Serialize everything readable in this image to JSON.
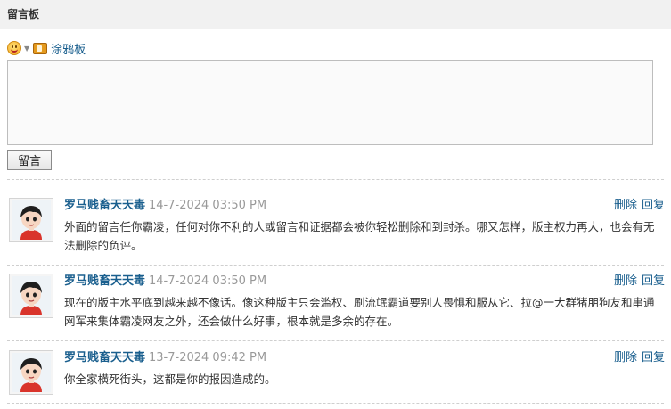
{
  "header": {
    "title": "留言板"
  },
  "editor": {
    "doodle_label": "涂鸦板",
    "textarea_value": "",
    "submit_label": "留言"
  },
  "comments": [
    {
      "author": "罗马贱畜天天毒",
      "time": "14-7-2024 03:50 PM",
      "delete_label": "删除",
      "reply_label": "回复",
      "body": "外面的留言任你霸凌，任何对你不利的人或留言和证据都会被你轻松删除和到封杀。哪又怎样，版主权力再大，也会有无法删除的负评。"
    },
    {
      "author": "罗马贱畜天天毒",
      "time": "14-7-2024 03:50 PM",
      "delete_label": "删除",
      "reply_label": "回复",
      "body": "现在的版主水平底到越来越不像话。像这种版主只会滥权、刷流氓霸道要别人畏惧和服从它、拉@一大群猪朋狗友和串通网军来集体霸凌网友之外，还会做什么好事，根本就是多余的存在。"
    },
    {
      "author": "罗马贱畜天天毒",
      "time": "13-7-2024 09:42 PM",
      "delete_label": "删除",
      "reply_label": "回复",
      "body": "你全家横死街头，这都是你的报因造成的。"
    }
  ],
  "icons": {
    "smiley": "smiley-icon",
    "doodle": "doodle-board-icon",
    "avatar": "default-avatar"
  }
}
